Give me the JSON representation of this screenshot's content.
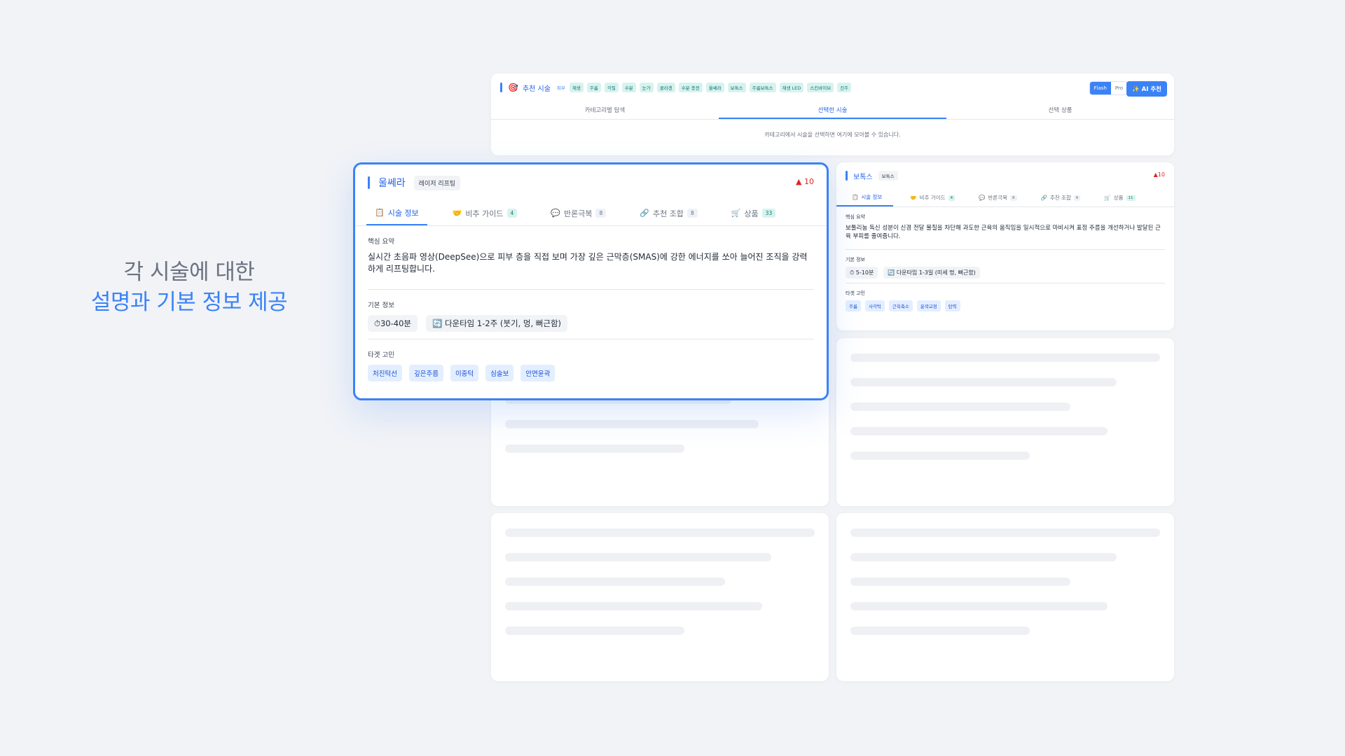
{
  "headline": {
    "line1": "각 시술에 대한",
    "line2": "설명과 기본 정보 제공"
  },
  "recommend_bar": {
    "icon": "🎯",
    "title": "추천 시술",
    "chips": [
      "피부",
      "재생",
      "주름",
      "각질",
      "수분",
      "눈가",
      "콜라겐",
      "수분 충전",
      "울쎄라",
      "보톡스",
      "주름보톡스",
      "재생 LED",
      "스킨바이브",
      "진주"
    ],
    "mode_options": [
      "Flash",
      "Pro"
    ],
    "mode_selected": "Flash",
    "ai_button": "✨ AI 추천",
    "tabs": [
      "카테고리별 탐색",
      "선택한 시술",
      "선택 상품"
    ],
    "active_tab": "선택한 시술",
    "hint": "카테고리에서 시술을 선택하면 여기에 모아볼 수 있습니다."
  },
  "main_card": {
    "name": "울쎄라",
    "tag": "레이저 리프팅",
    "warning": "▲ 10",
    "tabs": [
      {
        "icon": "📋",
        "label": "시술 정보",
        "count": ""
      },
      {
        "icon": "🤝",
        "label": "비추 가이드",
        "count": "4"
      },
      {
        "icon": "💬",
        "label": "반론극복",
        "count": "8"
      },
      {
        "icon": "🔗",
        "label": "추천 조합",
        "count": "8"
      },
      {
        "icon": "🛒",
        "label": "상품",
        "count": "33"
      }
    ],
    "summary_label": "핵심 요약",
    "summary": "실시간 초음파 영상(DeepSee)으로 피부 층을 직접 보며 가장 깊은 근막층(SMAS)에 강한 에너지를 쏘아 늘어진 조직을 강력하게 리프팅합니다.",
    "basic_label": "기본 정보",
    "duration": "⏱30-40분",
    "downtime": "🔄 다운타임 1-2주 (붓기, 멍, 뻐근함)",
    "target_label": "타겟 고민",
    "targets": [
      "처진턱선",
      "깊은주름",
      "이중턱",
      "심술보",
      "안면윤곽"
    ]
  },
  "small_card": {
    "name": "보톡스",
    "tag": "보톡스",
    "warning": "▲10",
    "tabs": [
      {
        "icon": "📋",
        "label": "시술 정보",
        "count": ""
      },
      {
        "icon": "🤝",
        "label": "비추 가이드",
        "count": "4"
      },
      {
        "icon": "💬",
        "label": "반론극복",
        "count": "8"
      },
      {
        "icon": "🔗",
        "label": "추천 조합",
        "count": "6"
      },
      {
        "icon": "🛒",
        "label": "상품",
        "count": "11"
      }
    ],
    "summary_label": "핵심 요약",
    "summary": "보툴리눔 독신 성분이 신경 전달 물질을 차단해 과도한 근육의 움직임을 일시적으로 마비시켜 표정 주름을 개선하거나 발달된 근육 부피를 줄여줍니다.",
    "basic_label": "기본 정보",
    "duration": "⏱ 5-10분",
    "downtime": "🔄 다운타임 1-3일 (미세 멍, 뻐근함)",
    "target_label": "타겟 고민",
    "targets": [
      "주름",
      "사각턱",
      "근육축소",
      "윤곽교정",
      "탄력"
    ]
  }
}
